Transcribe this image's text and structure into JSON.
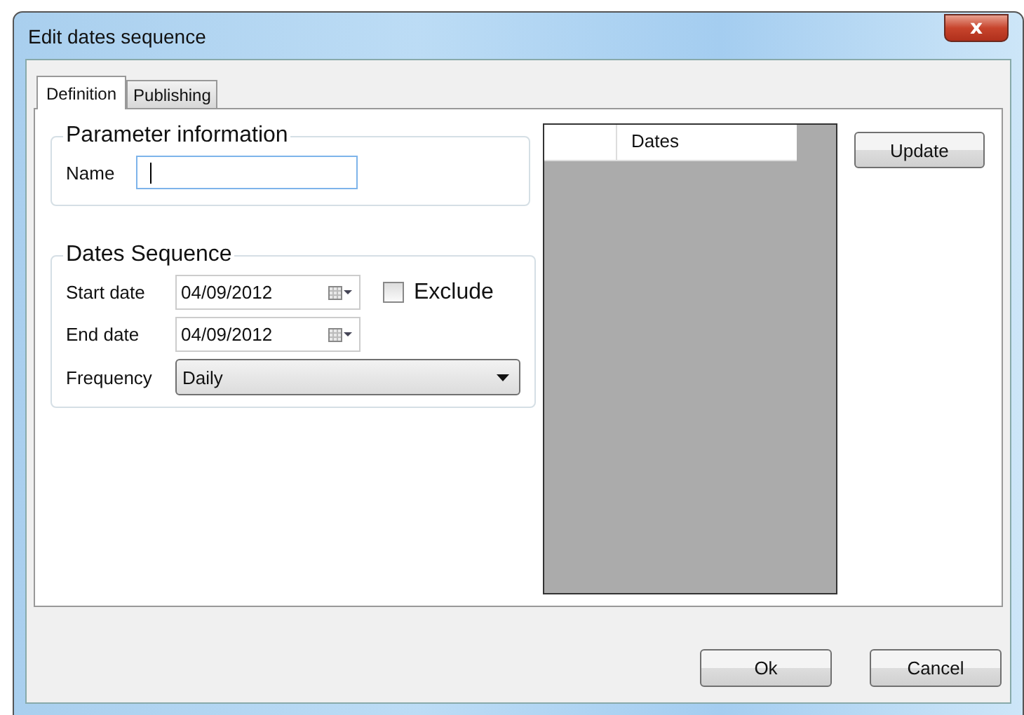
{
  "window": {
    "title": "Edit dates sequence",
    "close": "x"
  },
  "tabs": [
    {
      "label": "Definition",
      "selected": true
    },
    {
      "label": "Publishing",
      "selected": false
    }
  ],
  "parameter_information": {
    "title": "Parameter information",
    "name_label": "Name"
  },
  "dates_sequence": {
    "title": "Dates Sequence",
    "start_label": "Start date",
    "start_value": "04/09/2012",
    "end_label": "End date",
    "end_value": "04/09/2012",
    "exclude": {
      "label": "Exclude",
      "checked": false
    },
    "frequency_label": "Frequency",
    "frequency_value": "Daily"
  },
  "grid": {
    "columns": [
      "Dates"
    ]
  },
  "update_button": "Update",
  "buttons": [
    "Ok",
    "Cancel"
  ]
}
